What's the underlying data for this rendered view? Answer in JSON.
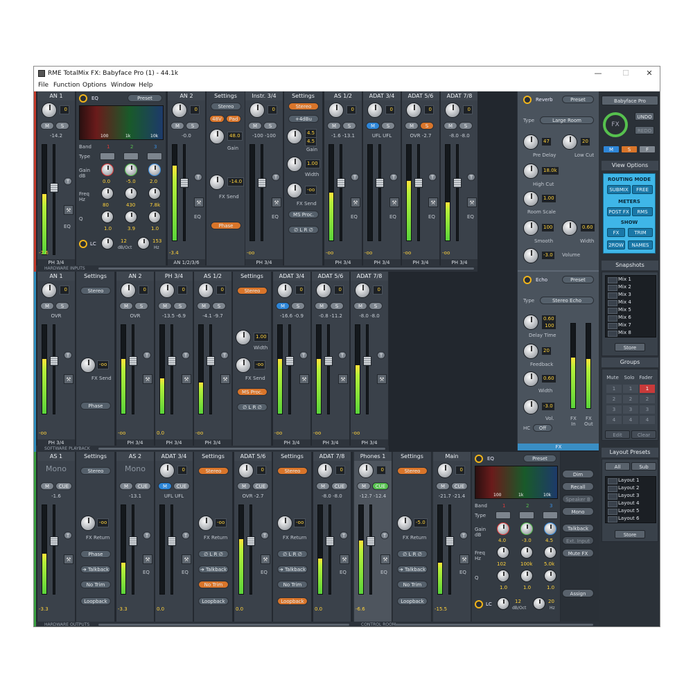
{
  "window": {
    "title": "RME TotalMix FX: Babyface Pro (1) - 44.1k",
    "menu": [
      "File",
      "Function",
      "Options",
      "Window",
      "Help"
    ],
    "controls": {
      "minimize": "—",
      "maximize": "☐",
      "close": "✕"
    }
  },
  "hardware_inputs": {
    "label": "HARDWARE INPUTS",
    "channels": [
      {
        "name": "AN 1",
        "gain": "0",
        "vals": "-14.2",
        "level": "-7.6",
        "foot": "PH 3/4",
        "meter": 0.55
      },
      {
        "name": "AN 2",
        "gain": "0",
        "vals": "-0.0",
        "level": "-3.4",
        "foot": "AN 1/2/3/6",
        "meter": 0.78
      },
      {
        "name": "Instr. 3/4",
        "gain": "0",
        "vals": "-100  -100",
        "level": "-oo",
        "foot": "PH 3/4",
        "meter": 0.0
      },
      {
        "name": "AS 1/2",
        "gain": "0",
        "vals": "-1.6  -13.1",
        "level": "-oo",
        "foot": "PH 3/4",
        "meter": 0.5
      },
      {
        "name": "ADAT 3/4",
        "gain": "0",
        "vals": "UFL  UFL",
        "level": "-oo",
        "foot": "PH 3/4",
        "meter": 0.0
      },
      {
        "name": "ADAT 5/6",
        "gain": "0",
        "vals": "OVR  -2.7",
        "level": "-oo",
        "foot": "PH 3/4",
        "meter": 0.62
      },
      {
        "name": "ADAT 7/8",
        "gain": "0",
        "vals": "-8.0  -8.0",
        "level": "-oo",
        "foot": "PH 3/4",
        "meter": 0.4
      }
    ],
    "eq": {
      "title": "EQ",
      "preset": "Preset",
      "band": "Band",
      "type": "Type",
      "gain": "Gain\ndB",
      "freq": "Freq\nHz",
      "q": "Q",
      "bands": [
        "1",
        "2",
        "3"
      ],
      "gains": [
        "0.0",
        "-5.0",
        "2.0"
      ],
      "freqs": [
        "80",
        "430",
        "7.8k"
      ],
      "qs": [
        "1.0",
        "3.9",
        "1.0"
      ],
      "axis": [
        "100",
        "1k",
        "10k"
      ],
      "lc": "LC",
      "lc_slope": "12",
      "lc_unit": "dB/Oct",
      "lc_freq": "153",
      "lc_hz": "Hz"
    },
    "settings_an2": {
      "title": "Settings",
      "stereo": "Stereo",
      "p48": "48V",
      "pad": "Pad",
      "gain_val": "48.0",
      "gain_lab": "Gain",
      "fx_val": "-14.0",
      "fx_lab": "FX Send",
      "phase": "Phase"
    },
    "settings_instr": {
      "title": "Settings",
      "stereo": "Stereo",
      "dbu": "+4dBu",
      "g1": "4.5",
      "g2": "4.5",
      "gain_lab": "Gain",
      "width_val": "1.00",
      "width_lab": "Width",
      "fx_val": "-oo",
      "fx_lab": "FX Send",
      "ms": "MS Proc.",
      "lr": "∅ L  R ∅"
    }
  },
  "software_playback": {
    "label": "SOFTWARE PLAYBACK",
    "channels": [
      {
        "name": "AN 1",
        "vals": "OVR",
        "level": "-oo",
        "foot": "PH 3/4",
        "meter": 0.62
      },
      {
        "name": "AN 2",
        "vals": "OVR",
        "level": "-oo",
        "foot": "PH 3/4",
        "meter": 0.62
      },
      {
        "name": "PH 3/4",
        "vals": "-13.5  -6.9",
        "level": "0.0",
        "foot": "PH 3/4",
        "meter": 0.4
      },
      {
        "name": "AS 1/2",
        "vals": "-4.1  -9.7",
        "level": "-oo",
        "foot": "PH 3/4",
        "meter": 0.35
      },
      {
        "name": "ADAT 3/4",
        "vals": "-16.6  -0.9",
        "level": "-oo",
        "foot": "PH 3/4",
        "meter": 0.62
      },
      {
        "name": "ADAT 5/6",
        "vals": "-0.8  -11.2",
        "level": "-oo",
        "foot": "PH 3/4",
        "meter": 0.62
      },
      {
        "name": "ADAT 7/8",
        "vals": "-8.0  -8.0",
        "level": "-oo",
        "foot": "PH 3/4",
        "meter": 0.55
      }
    ],
    "settings1": {
      "title": "Settings",
      "stereo": "Stereo",
      "fx_val": "-oo",
      "fx_lab": "FX Send",
      "phase": "Phase"
    },
    "settings2": {
      "title": "Settings",
      "stereo": "Stereo",
      "width_val": "1.00",
      "width_lab": "Width",
      "fx_val": "-oo",
      "fx_lab": "FX Send",
      "ms": "MS Proc.",
      "lr": "∅ L  R ∅"
    }
  },
  "hardware_outputs": {
    "label": "HARDWARE OUTPUTS",
    "channels": [
      {
        "name": "AS 1",
        "mono": "Mono",
        "vals": "-1.6",
        "level": "-3.3",
        "meter": 0.45
      },
      {
        "name": "AS 2",
        "mono": "Mono",
        "vals": "-13.1",
        "level": "-3.3",
        "meter": 0.35
      },
      {
        "name": "ADAT 3/4",
        "vals": "UFL  UFL",
        "level": "0.0",
        "meter": 0.0
      },
      {
        "name": "ADAT 5/6",
        "vals": "OVR  -2.7",
        "level": "0.0",
        "meter": 0.62
      },
      {
        "name": "ADAT 7/8",
        "vals": "-8.0  -8.0",
        "level": "0.0",
        "meter": 0.4
      }
    ],
    "settings": {
      "title": "Settings",
      "stereo": "Stereo",
      "fx_val": "-oo",
      "fx_lab": "FX Return",
      "phase": "Phase",
      "talkback": "➔ Talkback",
      "notrim": "No Trim",
      "loopback": "Loopback",
      "lr": "∅ L  R ∅"
    }
  },
  "control_room": {
    "label": "CONTROL ROOM",
    "phones": {
      "name": "Phones 1",
      "vals": "-12.7  -12.4",
      "level": "-6.6",
      "meter": 0.6
    },
    "main": {
      "name": "Main",
      "vals": "-21.7  -21.4",
      "level": "-15.5",
      "meter": 0.35
    },
    "settings": {
      "title": "Settings",
      "stereo": "Stereo",
      "fx_val": "-5.0",
      "fx_lab": "FX Return",
      "lr": "∅ L  R ∅",
      "talkback": "➔ Talkback",
      "notrim": "No Trim",
      "loopback": "Loopback"
    },
    "eq": {
      "title": "EQ",
      "preset": "Preset",
      "band": "Band",
      "type": "Type",
      "gain": "Gain\ndB",
      "freq": "Freq\nHz",
      "q": "Q",
      "bands": [
        "1",
        "2",
        "3"
      ],
      "gains": [
        "4.0",
        "-3.0",
        "4.5"
      ],
      "freqs": [
        "102",
        "100k",
        "5.0k"
      ],
      "qs": [
        "1.0",
        "1.0",
        "1.0"
      ],
      "axis": [
        "100",
        "1k",
        "10k"
      ],
      "lc": "LC",
      "lc_slope": "12",
      "lc_unit": "dB/Oct",
      "lc_freq": "20",
      "lc_hz": "Hz"
    },
    "buttons": [
      "Dim",
      "Recall",
      "Speaker B",
      "Mono",
      "Talkback",
      "Ext. Input",
      "Mute FX",
      "Assign"
    ]
  },
  "fx": {
    "label": "FX",
    "reverb": {
      "title": "Reverb",
      "preset": "Preset",
      "type": "Type",
      "type_val": "Large Room",
      "predelay_val": "47",
      "predelay": "Pre Delay",
      "lowcut_val": "20",
      "lowcut": "Low Cut",
      "highcut_val": "18.0k",
      "highcut": "High Cut",
      "roomscale_val": "1.00",
      "roomscale": "Room Scale",
      "smooth_val": "100",
      "smooth": "Smooth",
      "width_val": "0.60",
      "width": "Width",
      "volume_val": "-3.0",
      "volume": "Volume"
    },
    "echo": {
      "title": "Echo",
      "preset": "Preset",
      "type": "Type",
      "type_val": "Stereo Echo",
      "delay_val": "0.60\n100",
      "delay": "Delay Time",
      "feedback_val": "20",
      "feedback": "Feedback",
      "width_val": "0.60",
      "width": "Width",
      "vol_val": "-3.0",
      "vol": "Vol.",
      "hc": "HC",
      "hc_val": "Off",
      "fxin": "FX\nIn",
      "fxout": "FX\nOut"
    }
  },
  "right": {
    "device": "Babyface Pro",
    "fx_knob": "FX",
    "undo": "UNDO",
    "redo": "REDO",
    "msf": [
      "M",
      "S",
      "F"
    ],
    "view_options": "View Options",
    "routing_mode": "ROUTING MODE",
    "submix": "SUBMIX",
    "free": "FREE",
    "meters": "METERS",
    "postfx": "POST FX",
    "rms": "RMS",
    "show": "SHOW",
    "fx": "FX",
    "trim": "TRIM",
    "row2": "2ROW",
    "names": "NAMES",
    "snapshots": "Snapshots",
    "mixes": [
      "Mix 1",
      "Mix 2",
      "Mix 3",
      "Mix 4",
      "Mix 5",
      "Mix 6",
      "Mix 7",
      "Mix 8"
    ],
    "store": "Store",
    "groups": "Groups",
    "group_heads": [
      "Mute",
      "Solo",
      "Fader"
    ],
    "group_cells": [
      "1",
      "1",
      "1",
      "2",
      "2",
      "2",
      "3",
      "3",
      "3",
      "4",
      "4",
      "4"
    ],
    "edit": "Edit",
    "clear": "Clear",
    "layout_presets": "Layout Presets",
    "all": "All",
    "sub": "Sub",
    "layouts": [
      "Layout 1",
      "Layout 2",
      "Layout 3",
      "Layout 4",
      "Layout 5",
      "Layout 6"
    ],
    "store2": "Store"
  },
  "common": {
    "m": "M",
    "s": "S",
    "t": "T",
    "eq": "EQ",
    "cue": "CUE",
    "wrench": "🔧"
  },
  "colors": {
    "accent_orange": "#d9752a",
    "accent_blue": "#2e86d8",
    "meter_green": "#5ad43a",
    "view_cyan": "#3fb6e8"
  }
}
